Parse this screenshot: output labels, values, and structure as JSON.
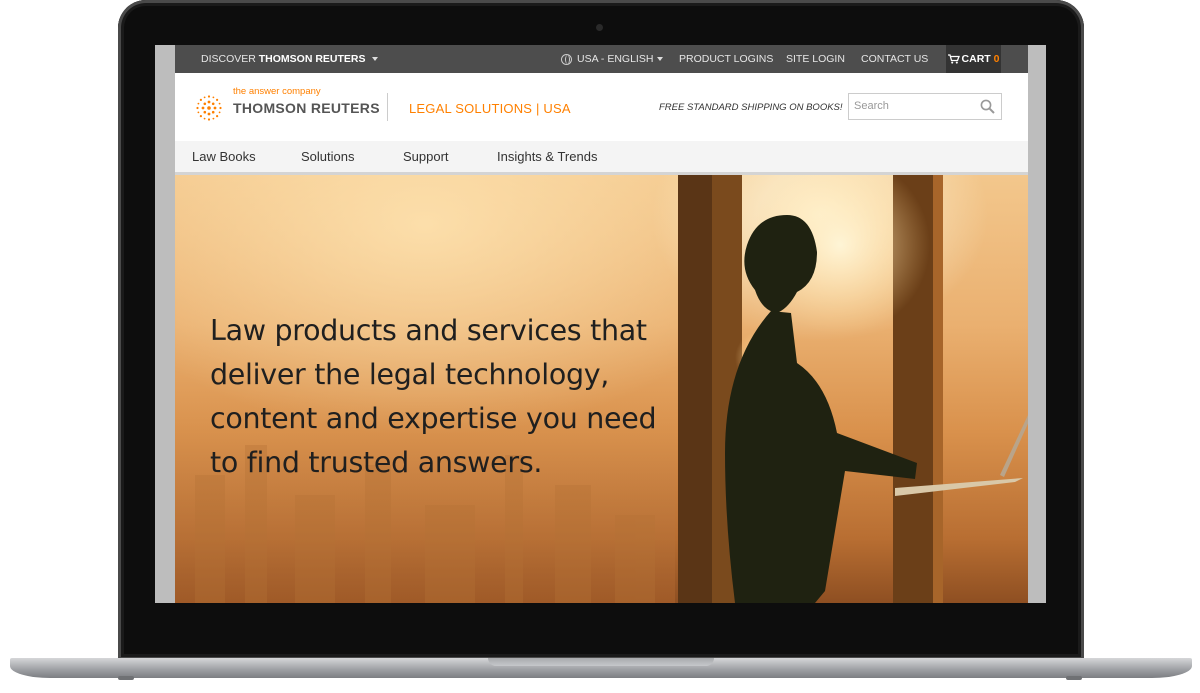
{
  "topbar": {
    "discover_prefix": "DISCOVER",
    "discover_brand": "THOMSON REUTERS",
    "region": "USA - ENGLISH",
    "product_logins": "PRODUCT LOGINS",
    "site_login": "SITE LOGIN",
    "contact_us": "CONTACT US",
    "cart_label": "CART",
    "cart_count": "0"
  },
  "header": {
    "tagline": "the answer company",
    "brand": "THOMSON REUTERS",
    "section": "LEGAL SOLUTIONS | USA",
    "shipping_note": "FREE STANDARD SHIPPING ON BOOKS!",
    "search_placeholder": "Search"
  },
  "nav": {
    "items": [
      "Law Books",
      "Solutions",
      "Support",
      "Insights & Trends"
    ]
  },
  "hero": {
    "lines": [
      "Law products and services that",
      "deliver the legal technology,",
      "content and expertise you need",
      "to find trusted answers."
    ]
  },
  "colors": {
    "accent": "#ff8000",
    "topbar": "#4d4d4d",
    "nav_bg": "#f4f4f4"
  }
}
